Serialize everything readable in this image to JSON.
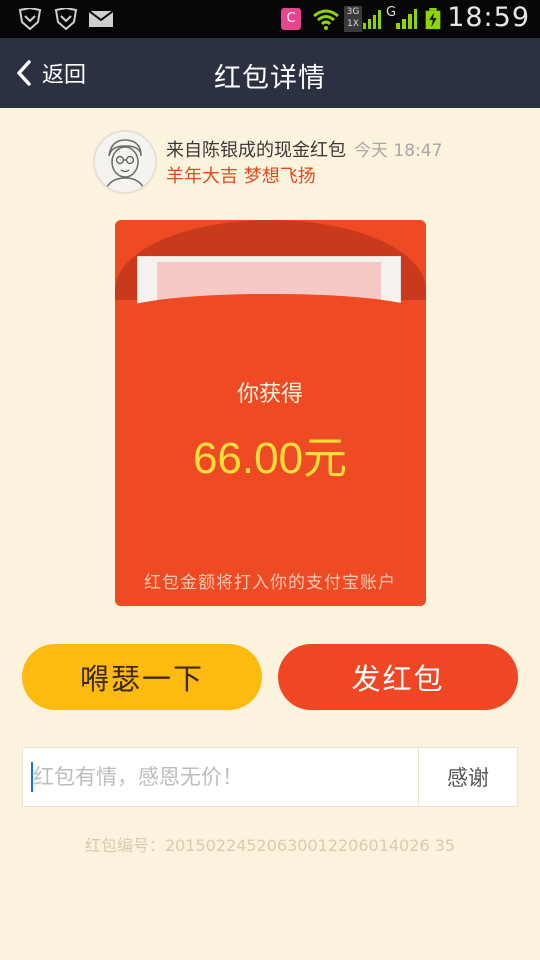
{
  "status_bar": {
    "time": "18:59",
    "network_badge": "3G",
    "network_sub": "1X",
    "signal_label": "G",
    "app_badge": "C"
  },
  "header": {
    "back_label": "返回",
    "title": "红包详情"
  },
  "sender": {
    "from_text": "来自陈银成的现金红包",
    "time": "今天 18:47",
    "wish": "羊年大吉 梦想飞扬"
  },
  "envelope": {
    "gain_label": "你获得",
    "amount": "66.00元",
    "note": "红包金额将打入你的支付宝账户"
  },
  "actions": {
    "shake_label": "嘚瑟一下",
    "send_label": "发红包"
  },
  "thanks": {
    "placeholder": "红包有情，感恩无价！",
    "button_label": "感谢"
  },
  "serial": "红包编号：20150224520630012206014026 35",
  "colors": {
    "header_bg": "#2b3140",
    "envelope_red": "#ee4a24",
    "amount_yellow": "#ffe03a",
    "shake_button": "#fdba0f",
    "send_button": "#f04623",
    "wish_text": "#e2491e"
  }
}
